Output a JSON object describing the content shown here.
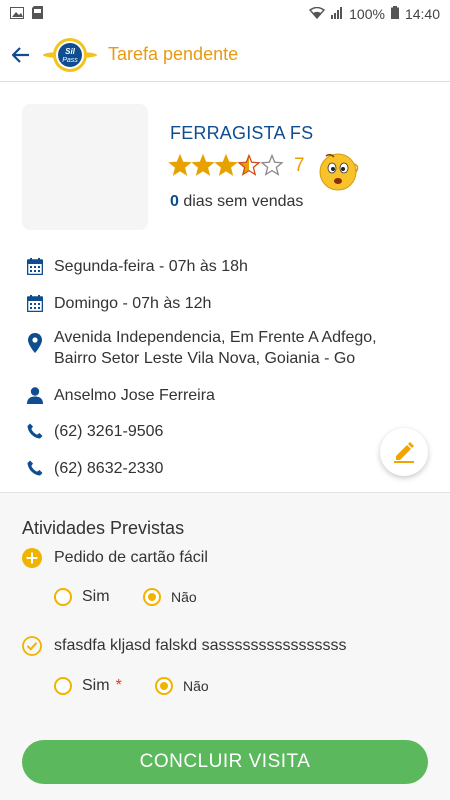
{
  "statusbar": {
    "battery": "100%",
    "time": "14:40"
  },
  "header": {
    "title": "Tarefa pendente",
    "logo_text": "Sil Pass"
  },
  "store": {
    "name": "FERRAGISTA FS",
    "rating_value": 3.5,
    "rating_max": 5,
    "rating_count": "7",
    "days_count": "0",
    "days_text": " dias sem vendas"
  },
  "info": {
    "hours_weekday": "Segunda-feira - 07h às 18h",
    "hours_sunday": "Domingo - 07h às 12h",
    "address_line1": "Avenida Independencia, Em Frente A Adfego,",
    "address_line2": "Bairro Setor Leste Vila Nova, Goiania - Go",
    "contact": "Anselmo Jose Ferreira",
    "phone1": "(62) 3261-9506",
    "phone2": "(62) 8632-2330"
  },
  "activities": {
    "title": "Atividades Previstas",
    "items": [
      {
        "label": "Pedido de cartão fácil",
        "yes": "Sim",
        "no": "Não",
        "selected": "no"
      },
      {
        "label": "sfasdfa kljasd falskd  sassssssssssssssss",
        "yes": "Sim",
        "required_mark": "*",
        "no": "Não",
        "selected": "no"
      }
    ]
  },
  "button": {
    "label": "CONCLUIR VISITA"
  },
  "colors": {
    "accent": "#e79a12",
    "brand_blue": "#0e4d90",
    "success": "#5cb85c",
    "radio": "#f0b400"
  }
}
